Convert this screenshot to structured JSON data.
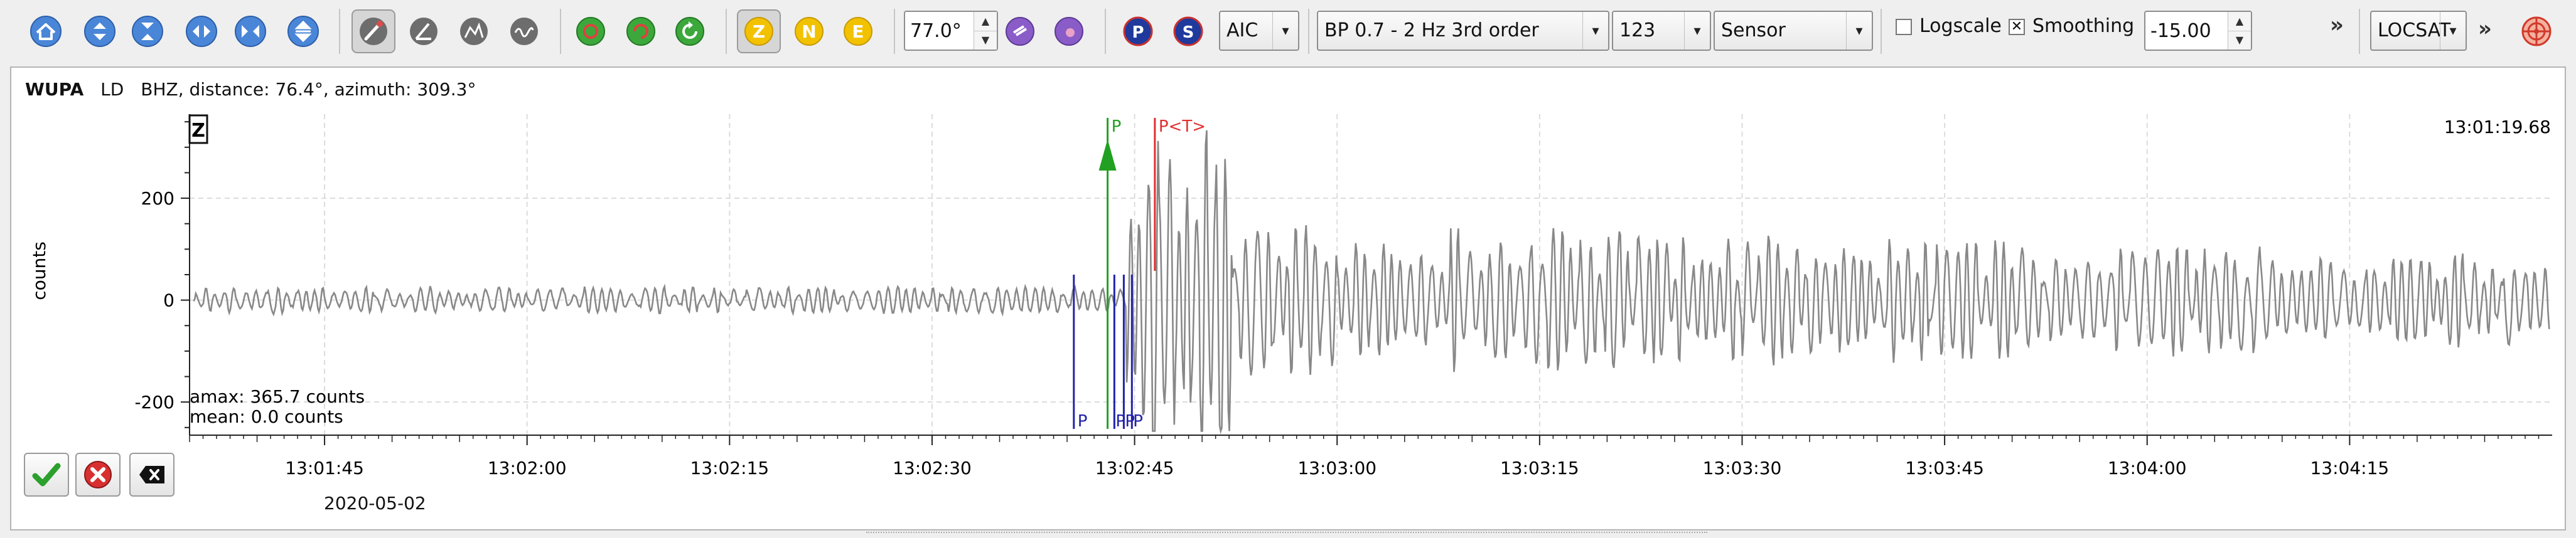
{
  "toolbar": {
    "filter_angle": "77.0°",
    "picker_method": "AIC",
    "filter": "BP 0.7 - 2 Hz  3rd order",
    "channel_order": "123",
    "unit_mode": "Sensor",
    "logscale_label": "Logscale",
    "logscale_checked": false,
    "smoothing_label": "Smoothing",
    "smoothing_checked": true,
    "smoothing_value": "-15.00",
    "locator": "LOCSAT",
    "component_buttons": [
      "Z",
      "N",
      "E"
    ],
    "phase_buttons": [
      "P",
      "S"
    ],
    "overflow_glyph": "»",
    "extra_glyph": "»"
  },
  "trace": {
    "station": "WUPA",
    "network": "LD",
    "channel": "BHZ",
    "info": "distance: 76.4°, azimuth: 309.3°",
    "component": "Z",
    "end_time_label": "13:01:19.68",
    "amax": "amax: 365.7 counts",
    "mean": "mean: 0.0 counts",
    "date": "2020-05-02"
  },
  "picks": [
    {
      "label": "P",
      "kind": "manual",
      "color": "#22a022",
      "time_s": 58.0
    },
    {
      "label": "P<T>",
      "kind": "theoretical",
      "color": "#e03030",
      "time_s": 61.5
    },
    {
      "label": "P",
      "kind": "automatic",
      "color": "#2222aa",
      "time_s": 55.5
    },
    {
      "label": "P",
      "kind": "automatic",
      "color": "#2222aa",
      "time_s": 58.5
    },
    {
      "label": "P",
      "kind": "automatic",
      "color": "#2222aa",
      "time_s": 59.2
    },
    {
      "label": "P",
      "kind": "automatic",
      "color": "#2222aa",
      "time_s": 59.8
    }
  ],
  "chart_data": {
    "type": "line",
    "ylabel": "counts",
    "yticks": [
      200,
      0,
      -200
    ],
    "ylim": [
      -265,
      365
    ],
    "xlim_s": [
      -10,
      165
    ],
    "x_ticks": [
      "13:01:45",
      "13:02:00",
      "13:02:15",
      "13:02:30",
      "13:02:45",
      "13:03:00",
      "13:03:15",
      "13:03:30",
      "13:03:45",
      "13:04:00",
      "13:04:15"
    ],
    "x_tick_times_s": [
      0,
      15,
      30,
      45,
      60,
      75,
      90,
      105,
      120,
      135,
      150
    ],
    "grid": true,
    "series_color": "#888888",
    "noise_amplitude": 22,
    "signal_onset_s": 59,
    "peak_amplitude": 360,
    "coda_amplitude": 140
  }
}
